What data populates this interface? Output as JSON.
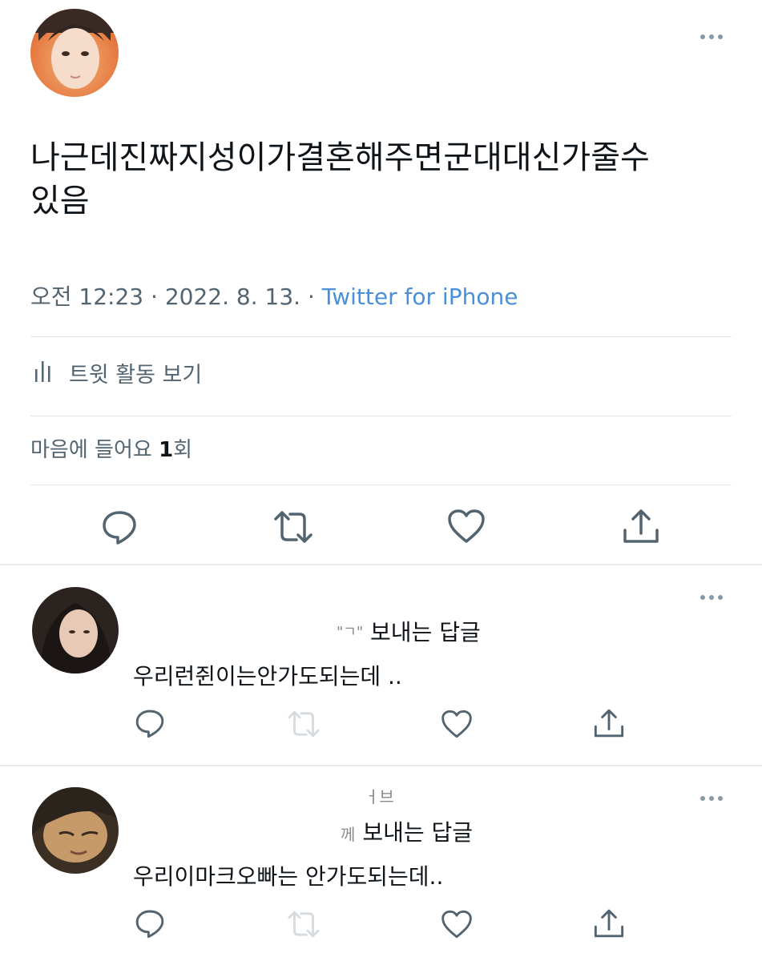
{
  "main_tweet": {
    "more_icon": "more-horizontal-icon",
    "text_line1": "나근데진짜지성이가결혼해주면군대대신가줄수",
    "text_line2": "있음",
    "time": "오전 12:23",
    "date": "2022. 8. 13.",
    "source": "Twitter for iPhone",
    "dot": "·",
    "activity_icon": "analytics-icon",
    "activity_label": "트윗 활동 보기",
    "likes_label": "마음에 들어요",
    "likes_count": "1",
    "likes_suffix": "회",
    "actions": [
      "reply-icon",
      "retweet-icon",
      "like-icon",
      "share-icon"
    ]
  },
  "replies": [
    {
      "name_fragment": "",
      "reply_to_fragment": "\"ㄱ\"",
      "reply_to_label": "보내는 답글",
      "text": "우리런쥔이는안가도되는데 .."
    },
    {
      "name_fragment": "ㅓ브",
      "reply_to_fragment": "께",
      "reply_to_label": "보내는 답글",
      "text": "우리이마크오빠는 안가도되는데.."
    }
  ],
  "colors": {
    "text": "#0f1419",
    "muted": "#536471",
    "link": "#4a90d9",
    "divider": "#e1e6ea"
  }
}
